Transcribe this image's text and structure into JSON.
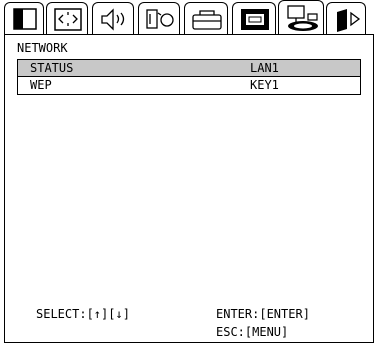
{
  "tabs": [
    {
      "name": "picture-tab",
      "icon": "split-screen-icon"
    },
    {
      "name": "image-tab",
      "icon": "keystone-icon"
    },
    {
      "name": "audio-tab",
      "icon": "speaker-icon"
    },
    {
      "name": "setup-tab",
      "icon": "input-icon"
    },
    {
      "name": "options-tab",
      "icon": "toolbox-icon"
    },
    {
      "name": "screen-tab",
      "icon": "screen-icon"
    },
    {
      "name": "network-tab",
      "icon": "network-icon",
      "active": true
    },
    {
      "name": "next-tab",
      "icon": "next-page-icon"
    }
  ],
  "section_title": "NETWORK",
  "menu": {
    "items": [
      {
        "label": "STATUS",
        "value": "LAN1",
        "selected": true
      },
      {
        "label": "WEP",
        "value": "KEY1",
        "selected": false
      }
    ]
  },
  "footer": {
    "select": "SELECT:[↑][↓]",
    "enter": "ENTER:[ENTER]",
    "esc": "ESC:[MENU]"
  }
}
